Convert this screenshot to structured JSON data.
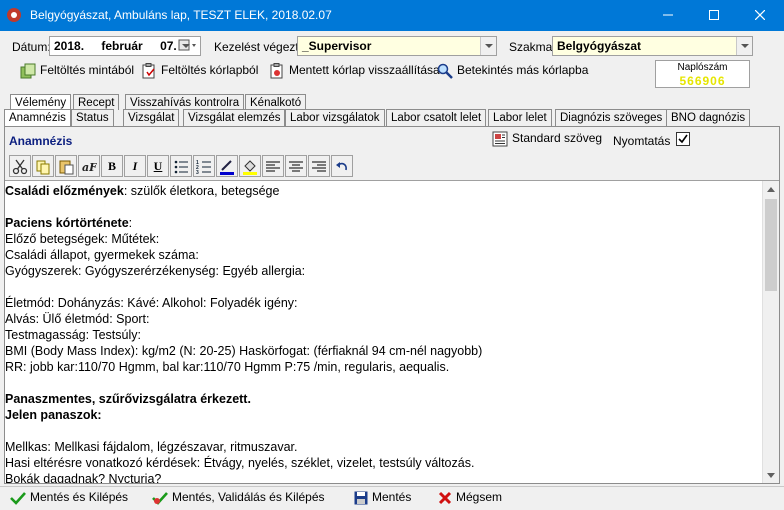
{
  "window": {
    "title": "Belgyógyászat, Ambuláns lap, TESZT ELEK, 2018.02.07",
    "icon": "app-logo-icon",
    "colors": {
      "titlebar": "#0078d7"
    }
  },
  "header": {
    "date_label": "Dátum:",
    "date_year": "2018.",
    "date_month": "február",
    "date_day": "07.",
    "performer_label": "Kezelést végezte:",
    "performer_value": "_Supervisor",
    "specialty_label": "Szakma:",
    "specialty_value": "Belgyógyászat"
  },
  "toolbar": {
    "fill_template": "Feltöltés mintából",
    "fill_history": "Feltöltés kórlapból",
    "restore_saved": "Mentett kórlap visszaállítása",
    "view_other": "Betekintés más kórlapba"
  },
  "log": {
    "caption": "Naplószám",
    "number": "566906"
  },
  "tabs_top": [
    "Vélemény",
    "Recept",
    "Visszahívás kontrolra",
    "Kénalkotó"
  ],
  "tabs_second": [
    "Anamnézis",
    "Status",
    "Vizsgálat",
    "Vizsgálat elemzés",
    "Labor vizsgálatok",
    "Labor csatolt lelet",
    "Labor lelet",
    "Diagnózis szöveges",
    "BNO dagnózis"
  ],
  "panel": {
    "title": "Anamnézis",
    "standard_text": "Standard szöveg",
    "print_label": "Nyomtatás",
    "print_checked": true
  },
  "editor_lines": [
    [
      {
        "t": "Családi előzmények",
        "b": true
      },
      {
        "t": ": szülők életkora, betegsége",
        "b": false
      }
    ],
    [],
    [
      {
        "t": "Paciens kórtörténete",
        "b": true
      },
      {
        "t": ":",
        "b": false
      }
    ],
    [
      {
        "t": "Előző betegségek:  Műtétek:",
        "b": false
      }
    ],
    [
      {
        "t": "Családi állapot, gyermekek száma:",
        "b": false
      }
    ],
    [
      {
        "t": "Gyógyszerek:  Gyógyszerérzékenység:     Egyéb allergia:",
        "b": false
      }
    ],
    [],
    [
      {
        "t": "Életmód: Dohányzás:   Kávé:   Alkohol:  Folyadék igény:",
        "b": false
      }
    ],
    [
      {
        "t": "Alvás:  Ülő életmód:  Sport:",
        "b": false
      }
    ],
    [
      {
        "t": "Testmagasság:    Testsúly:",
        "b": false
      }
    ],
    [
      {
        "t": "BMI (Body Mass Index):  kg/m2    (N: 20-25)  Haskörfogat:    (férfiaknál 94 cm-nél nagyobb)",
        "b": false
      }
    ],
    [
      {
        "t": "RR: jobb kar:110/70 Hgmm, bal kar:110/70 Hgmm  P:75 /min, regularis, aequalis.",
        "b": false
      }
    ],
    [],
    [
      {
        "t": "Panaszmentes, szűrővizsgálatra érkezett.",
        "b": true
      }
    ],
    [
      {
        "t": "Jelen panaszok:",
        "b": true
      }
    ],
    [],
    [
      {
        "t": "Mellkas: Mellkasi fájdalom, légzészavar, ritmuszavar.",
        "b": false
      }
    ],
    [
      {
        "t": "Hasi eltérésre vonatkozó kérdések: Étvágy, nyelés, széklet, vizelet, testsúly változás.",
        "b": false
      }
    ],
    [
      {
        "t": "Bokák dagadnak? Nycturia?",
        "b": false
      }
    ]
  ],
  "bottom": {
    "save_exit": "Mentés és Kilépés",
    "save_validate_exit": "Mentés, Validálás és Kilépés",
    "save": "Mentés",
    "cancel": "Mégsem"
  }
}
